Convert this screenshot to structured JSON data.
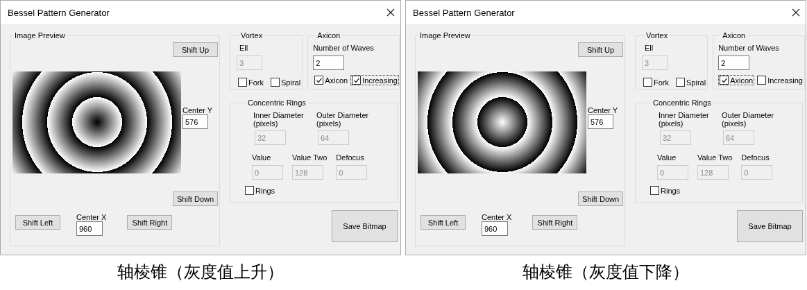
{
  "panels": [
    {
      "window": {
        "title": "Bessel Pattern Generator"
      },
      "image_preview": {
        "title": "Image Preview",
        "shift_up": "Shift Up",
        "center_y": {
          "label": "Center Y",
          "value": "576"
        },
        "shift_down": "Shift Down",
        "shift_left": "Shift Left",
        "center_x": {
          "label": "Center X",
          "value": "960"
        },
        "shift_right": "Shift Right"
      },
      "vortex": {
        "title": "Vortex",
        "ell": {
          "label": "Ell",
          "value": "3",
          "disabled": true
        },
        "checkboxes": [
          {
            "label": "Fork",
            "checked": false,
            "focused": false
          },
          {
            "label": "Spiral",
            "checked": false,
            "focused": false
          }
        ]
      },
      "axicon": {
        "title": "Axicon",
        "waves": {
          "label": "Number of Waves",
          "value": "2",
          "disabled": false
        },
        "checkboxes": [
          {
            "label": "Axicon",
            "checked": true,
            "focused": false
          },
          {
            "label": "Increasing",
            "checked": true,
            "focused": true
          }
        ]
      },
      "concentric_rings": {
        "title": "Concentric Rings",
        "diameters": [
          {
            "label": "Inner Diameter (pixels)",
            "value": "32",
            "disabled": true
          },
          {
            "label": "Outer Diameter (pixels)",
            "value": "64",
            "disabled": true
          }
        ],
        "values": [
          {
            "label": "Value",
            "value": "0",
            "disabled": true
          },
          {
            "label": "Value Two",
            "value": "128",
            "disabled": true
          },
          {
            "label": "Defocus",
            "value": "0",
            "disabled": true
          }
        ],
        "rings": {
          "label": "Rings",
          "checked": false,
          "focused": false
        }
      },
      "save_button": "Save Bitmap",
      "caption": "轴棱锥（灰度值上升）"
    },
    {
      "window": {
        "title": "Bessel Pattern Generator"
      },
      "image_preview": {
        "title": "Image Preview",
        "shift_up": "Shift Up",
        "center_y": {
          "label": "Center Y",
          "value": "576"
        },
        "shift_down": "Shift Down",
        "shift_left": "Shift Left",
        "center_x": {
          "label": "Center X",
          "value": "960"
        },
        "shift_right": "Shift Right"
      },
      "vortex": {
        "title": "Vortex",
        "ell": {
          "label": "Ell",
          "value": "3",
          "disabled": true
        },
        "checkboxes": [
          {
            "label": "Fork",
            "checked": false,
            "focused": false
          },
          {
            "label": "Spiral",
            "checked": false,
            "focused": false
          }
        ]
      },
      "axicon": {
        "title": "Axicon",
        "waves": {
          "label": "Number of Waves",
          "value": "2",
          "disabled": false
        },
        "checkboxes": [
          {
            "label": "Axicon",
            "checked": true,
            "focused": true
          },
          {
            "label": "Increasing",
            "checked": false,
            "focused": false
          }
        ]
      },
      "concentric_rings": {
        "title": "Concentric Rings",
        "diameters": [
          {
            "label": "Inner Diameter (pixels)",
            "value": "32",
            "disabled": true
          },
          {
            "label": "Outer Diameter (pixels)",
            "value": "64",
            "disabled": true
          }
        ],
        "values": [
          {
            "label": "Value",
            "value": "0",
            "disabled": true
          },
          {
            "label": "Value Two",
            "value": "128",
            "disabled": true
          },
          {
            "label": "Defocus",
            "value": "0",
            "disabled": true
          }
        ],
        "rings": {
          "label": "Rings",
          "checked": false,
          "focused": false
        }
      },
      "save_button": "Save Bitmap",
      "caption": "轴棱锥（灰度值下降）"
    }
  ]
}
